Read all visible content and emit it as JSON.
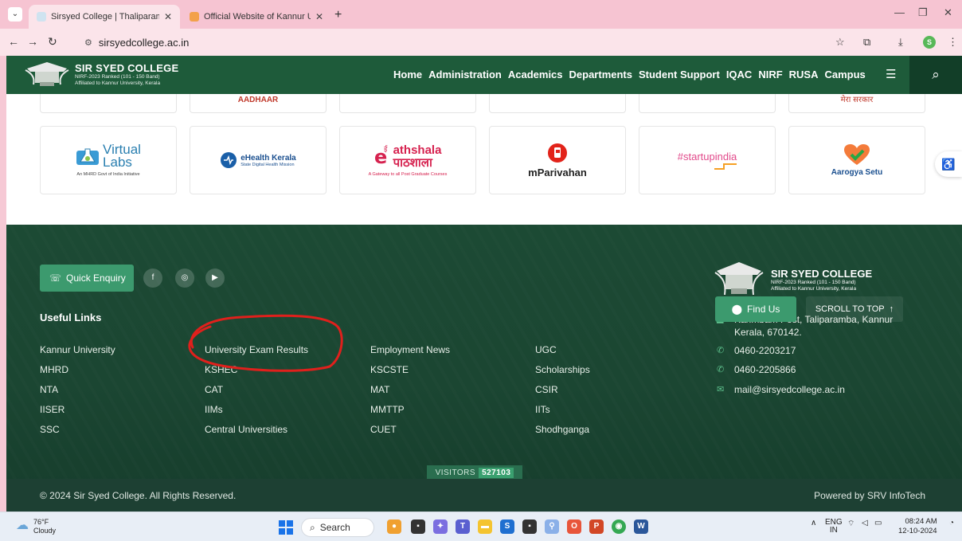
{
  "browser": {
    "tabs": [
      {
        "title": "Sirsyed College | Thaliparamba",
        "active": true
      },
      {
        "title": "Official Website of Kannur Univ",
        "active": false
      }
    ],
    "url": "sirsyedcollege.ac.in",
    "profile_initial": "S"
  },
  "site": {
    "name": "SIR SYED COLLEGE",
    "sub1": "NIRF-2023 Ranked (101 - 150 Band)",
    "sub2": "Affiliated to Kannur University, Kerala",
    "nav": [
      "Home",
      "Administration",
      "Academics",
      "Departments",
      "Student Support",
      "IQAC",
      "NIRF",
      "RUSA",
      "Campus"
    ]
  },
  "partners_top": [
    "AADHAAR",
    "",
    "",
    "",
    "मेरा सरकार"
  ],
  "partners": [
    {
      "name": "Virtual Labs",
      "line1": "Virtual",
      "line2": "Labs",
      "caption": "An MHRD Govt of India Initiative"
    },
    {
      "name": "eHealth Kerala",
      "line1": "eHealth Kerala",
      "caption": "State Digital Health Mission"
    },
    {
      "name": "ePathshala",
      "line1": "athshala",
      "line2": "पाठशाला",
      "caption": "A Gateway to all Post Graduate Courses"
    },
    {
      "name": "mParivahan",
      "line1": "mParivahan"
    },
    {
      "name": "Startup India",
      "line1": "#startupindia"
    },
    {
      "name": "Aarogya Setu",
      "line1": "Aarogya Setu"
    }
  ],
  "footer": {
    "quick_enquiry": "Quick Enquiry",
    "useful_links_title": "Useful Links",
    "links": [
      [
        "Kannur University",
        "MHRD",
        "NTA",
        "IISER",
        "SSC"
      ],
      [
        "University Exam Results",
        "KSHEC",
        "CAT",
        "IIMs",
        "Central Universities"
      ],
      [
        "Employment News",
        "KSCSTE",
        "MAT",
        "MMTTP",
        "CUET"
      ],
      [
        "UGC",
        "Scholarships",
        "CSIR",
        "IITs",
        "Shodhganga"
      ]
    ],
    "address_line1": "Karimbam Post, Taliparamba, Kannur",
    "address_line2": "Kerala, 670142.",
    "phone1": "0460-2203217",
    "phone2": "0460-2205866",
    "email": "mail@sirsyedcollege.ac.in",
    "find_us": "Find Us",
    "scroll_top": "SCROLL TO TOP",
    "visitors_label": "VISITORS",
    "visitors_count": "527103",
    "copyright": "© 2024 Sir Syed College. All Rights Reserved.",
    "powered_by": "Powered by SRV InfoTech"
  },
  "taskbar": {
    "temp": "76°F",
    "weather": "Cloudy",
    "search_placeholder": "Search",
    "lang1": "ENG",
    "lang2": "IN",
    "time": "08:24 AM",
    "date": "12-10-2024"
  },
  "annotation_color": "#e0201c"
}
